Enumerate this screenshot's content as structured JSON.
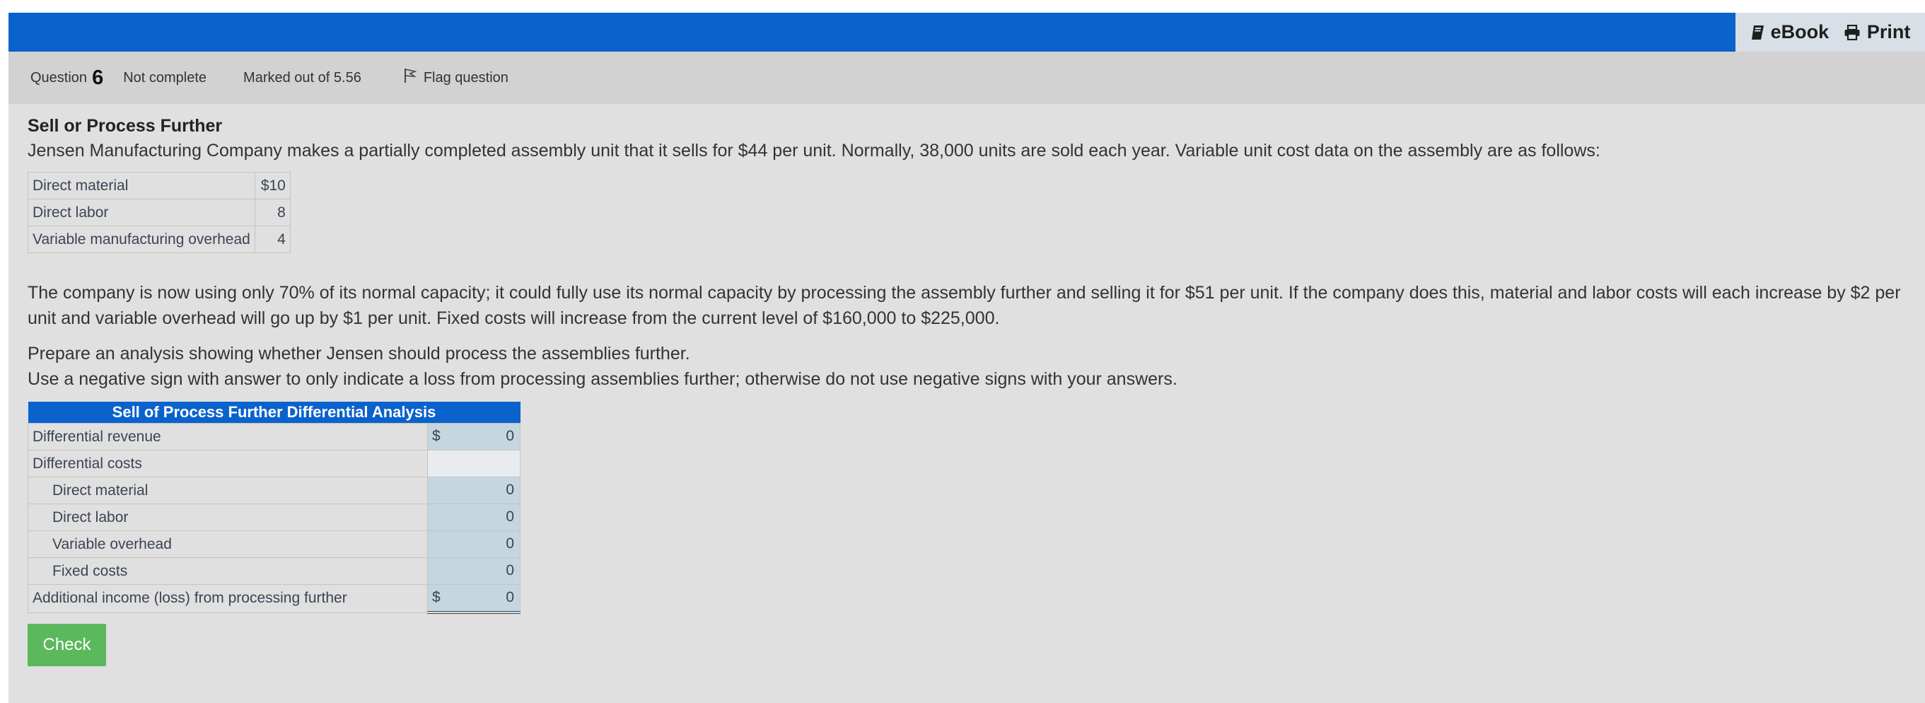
{
  "toolbar": {
    "ebook_label": "eBook",
    "print_label": "Print"
  },
  "question_info": {
    "label": "Question",
    "number": "6",
    "state": "Not complete",
    "marks": "Marked out of 5.56",
    "flag_label": "Flag question"
  },
  "problem": {
    "title": "Sell or Process Further",
    "intro": "Jensen Manufacturing Company makes a partially completed assembly unit that it sells for $44 per unit. Normally, 38,000 units are sold each year. Variable unit cost data on the assembly are as follows:",
    "cost_rows": [
      {
        "label": "Direct material",
        "value": "$10"
      },
      {
        "label": "Direct labor",
        "value": "8"
      },
      {
        "label": "Variable manufacturing overhead",
        "value": "4"
      }
    ],
    "capacity_text": "The company is now using only 70% of its normal capacity; it could fully use its normal capacity by processing the assembly further and selling it for $51 per unit. If the company does this, material and labor costs will each increase by $2 per unit and variable overhead will go up by $1 per unit. Fixed costs will increase from the current level of $160,000 to $225,000.",
    "instruction_1": "Prepare an analysis showing whether Jensen should process the assemblies further.",
    "instruction_2": "Use a negative sign with answer to only indicate a loss from processing assemblies further; otherwise do not use negative signs with your answers."
  },
  "analysis": {
    "header": "Sell of Process Further Differential Analysis",
    "rows": {
      "revenue": {
        "label": "Differential revenue",
        "currency": "$",
        "value": "0"
      },
      "costs": {
        "label": "Differential costs"
      },
      "material": {
        "label": "Direct material",
        "value": "0"
      },
      "labor": {
        "label": "Direct labor",
        "value": "0"
      },
      "overhead": {
        "label": "Variable overhead",
        "value": "0"
      },
      "fixed": {
        "label": "Fixed costs",
        "value": "0"
      },
      "total": {
        "label": "Additional income (loss) from processing further",
        "currency": "$",
        "value": "0"
      }
    }
  },
  "check_label": "Check",
  "colors": {
    "header_blue": "#0a62cd",
    "input_cell": "#c5d6df",
    "check_green": "#5cb85c"
  }
}
